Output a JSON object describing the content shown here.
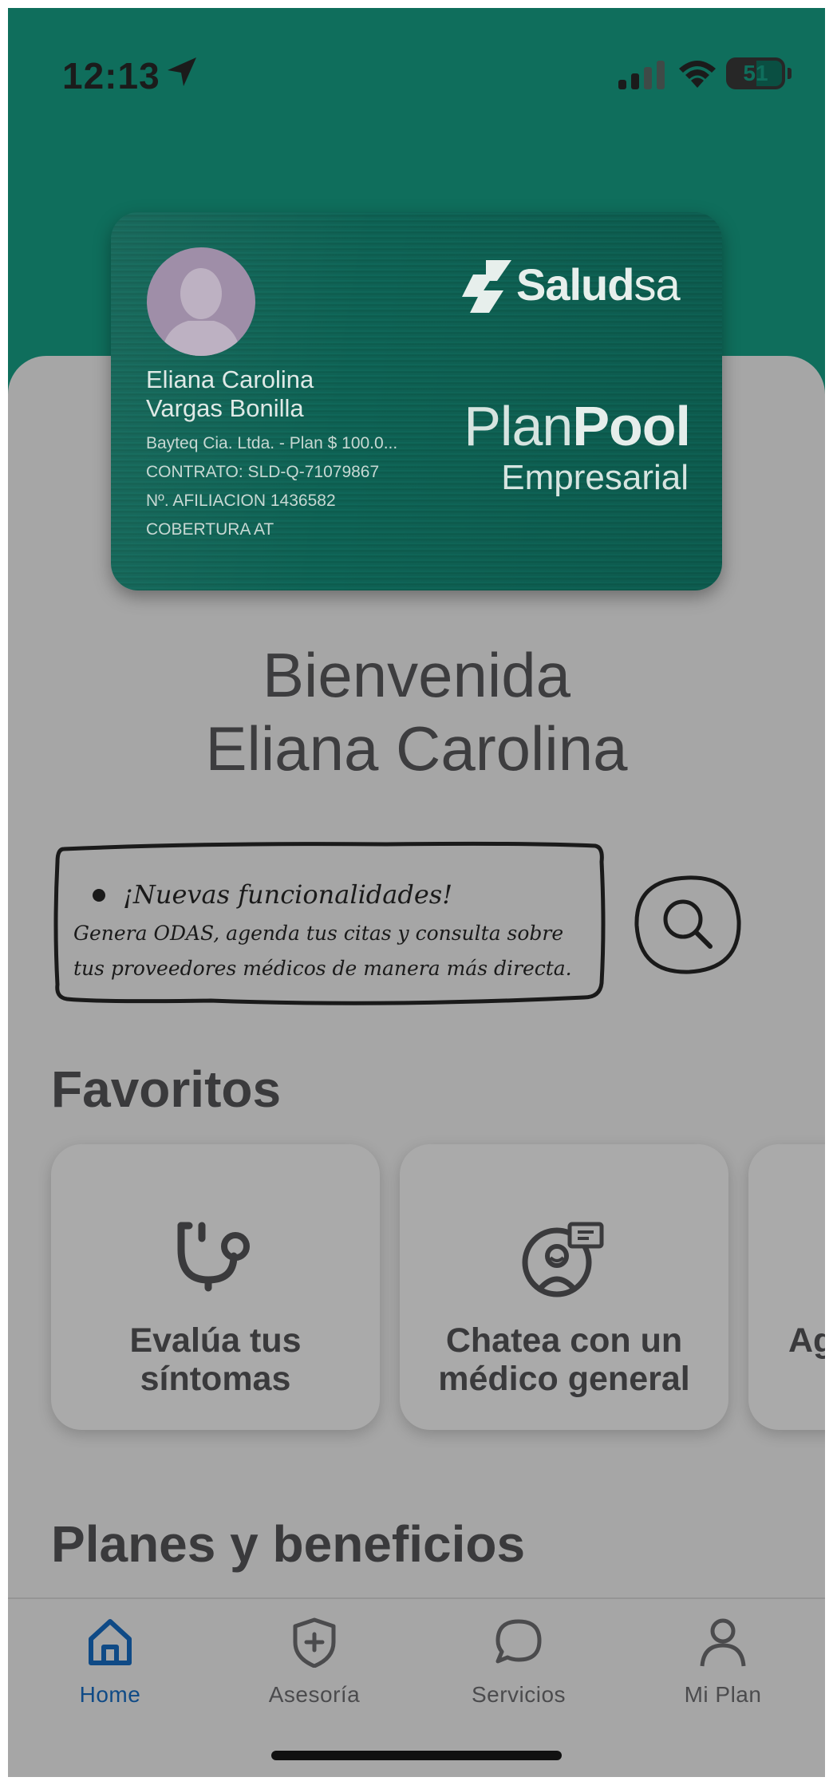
{
  "status_bar": {
    "time": "12:13",
    "battery_percent": "51",
    "icons": [
      "location-arrow-icon",
      "signal-icon",
      "wifi-icon",
      "battery-icon"
    ]
  },
  "member_card": {
    "brand": {
      "part1": "Salud",
      "part2": "sa"
    },
    "plan": {
      "light": "Plan",
      "bold": "Pool",
      "subtitle": "Empresarial"
    },
    "name_line1": "Eliana Carolina",
    "name_line2": "Vargas Bonilla",
    "company": "Bayteq Cia. Ltda. - Plan $ 100.0...",
    "contract": "CONTRATO: SLD-Q-71079867",
    "affiliation": "Nº. AFILIACION 1436582",
    "coverage": "COBERTURA AT"
  },
  "welcome": {
    "line1": "Bienvenida",
    "line2": "Eliana Carolina"
  },
  "notice": {
    "title": "¡Nuevas funcionalidades!",
    "body_line1": "Genera ODAS, agenda tus citas y consulta sobre",
    "body_line2": "tus proveedores médicos de manera más directa."
  },
  "favorites": {
    "title": "Favoritos",
    "items": [
      {
        "line1": "Evalúa tus",
        "line2": "síntomas",
        "icon": "stethoscope-icon"
      },
      {
        "line1": "Chatea con un",
        "line2": "médico general",
        "icon": "doctor-chat-icon"
      },
      {
        "line1": "Ag",
        "icon": "unknown"
      }
    ]
  },
  "plans": {
    "title": "Planes y beneficios"
  },
  "tab_bar": {
    "tabs": [
      {
        "label": "Home",
        "icon": "home-icon",
        "active": true
      },
      {
        "label": "Asesoría",
        "icon": "shield-plus-icon",
        "active": false
      },
      {
        "label": "Servicios",
        "icon": "chat-bubble-icon",
        "active": false
      },
      {
        "label": "Mi Plan",
        "icon": "person-icon",
        "active": false
      }
    ]
  },
  "colors": {
    "header_teal": "#0f6e5c",
    "overlay_gray": "#a6a6a6",
    "active_tab": "#0f4a86",
    "text_dark": "#3a3a3c"
  }
}
